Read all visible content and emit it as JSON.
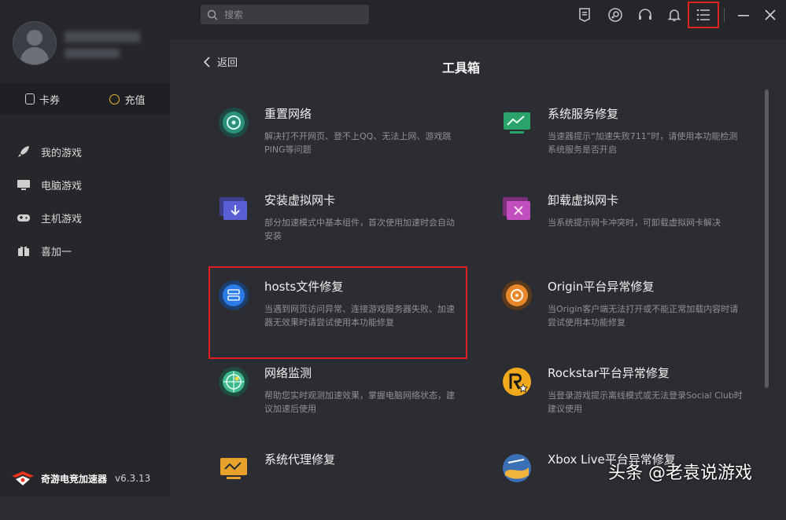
{
  "search": {
    "placeholder": "搜索"
  },
  "wallet": {
    "card_label": "卡券",
    "recharge_label": "充值"
  },
  "nav": [
    {
      "label": "我的游戏",
      "icon": "rocket-icon"
    },
    {
      "label": "电脑游戏",
      "icon": "monitor-icon"
    },
    {
      "label": "主机游戏",
      "icon": "gamepad-icon"
    },
    {
      "label": "喜加一",
      "icon": "gift-icon"
    }
  ],
  "brand": {
    "name": "奇游电竞加速器",
    "version": "v6.3.13"
  },
  "main": {
    "back_label": "返回",
    "title": "工具箱"
  },
  "tools": [
    {
      "name": "重置网络",
      "desc": "解决打不开网页、登不上QQ、无法上网、游戏跳PING等问题",
      "icon": "reset-network-icon",
      "color": "#38b59c"
    },
    {
      "name": "系统服务修复",
      "desc": "当速器提示“加速失败711”时，请使用本功能检测系统服务是否开启",
      "icon": "system-service-icon",
      "color": "#3cc47a"
    },
    {
      "name": "安装虚拟网卡",
      "desc": "部分加速模式中基本组件，首次使用加速时会自动安装",
      "icon": "install-nic-icon",
      "color": "#5a5fd6"
    },
    {
      "name": "卸载虚拟网卡",
      "desc": "当系统提示网卡冲突时，可卸载虚拟网卡解决",
      "icon": "uninstall-nic-icon",
      "color": "#c24fc0"
    },
    {
      "name": "hosts文件修复",
      "desc": "当遇到网页访问异常、连接游戏服务器失败、加速器无效果时请尝试使用本功能修复",
      "icon": "hosts-file-icon",
      "color": "#2b7be6"
    },
    {
      "name": "Origin平台异常修复",
      "desc": "当Origin客户端无法打开或不能正常加载内容时请尝试使用本功能修复",
      "icon": "origin-icon",
      "color": "#e8862a"
    },
    {
      "name": "网络监测",
      "desc": "帮助您实时观测加速效果，掌握电脑网络状态，建议加速后使用",
      "icon": "network-monitor-icon",
      "color": "#3fb98c"
    },
    {
      "name": "Rockstar平台异常修复",
      "desc": "当登录游戏提示离线模式或无法登录Social Club时建议使用",
      "icon": "rockstar-icon",
      "color": "#f0a81c"
    },
    {
      "name": "系统代理修复",
      "desc": "",
      "icon": "system-proxy-icon",
      "color": "#e8a12a"
    },
    {
      "name": "Xbox Live平台异常修复",
      "desc": "",
      "icon": "xbox-live-icon",
      "color": "#3b6fb6"
    }
  ],
  "watermark": "头条 @老袁说游戏"
}
